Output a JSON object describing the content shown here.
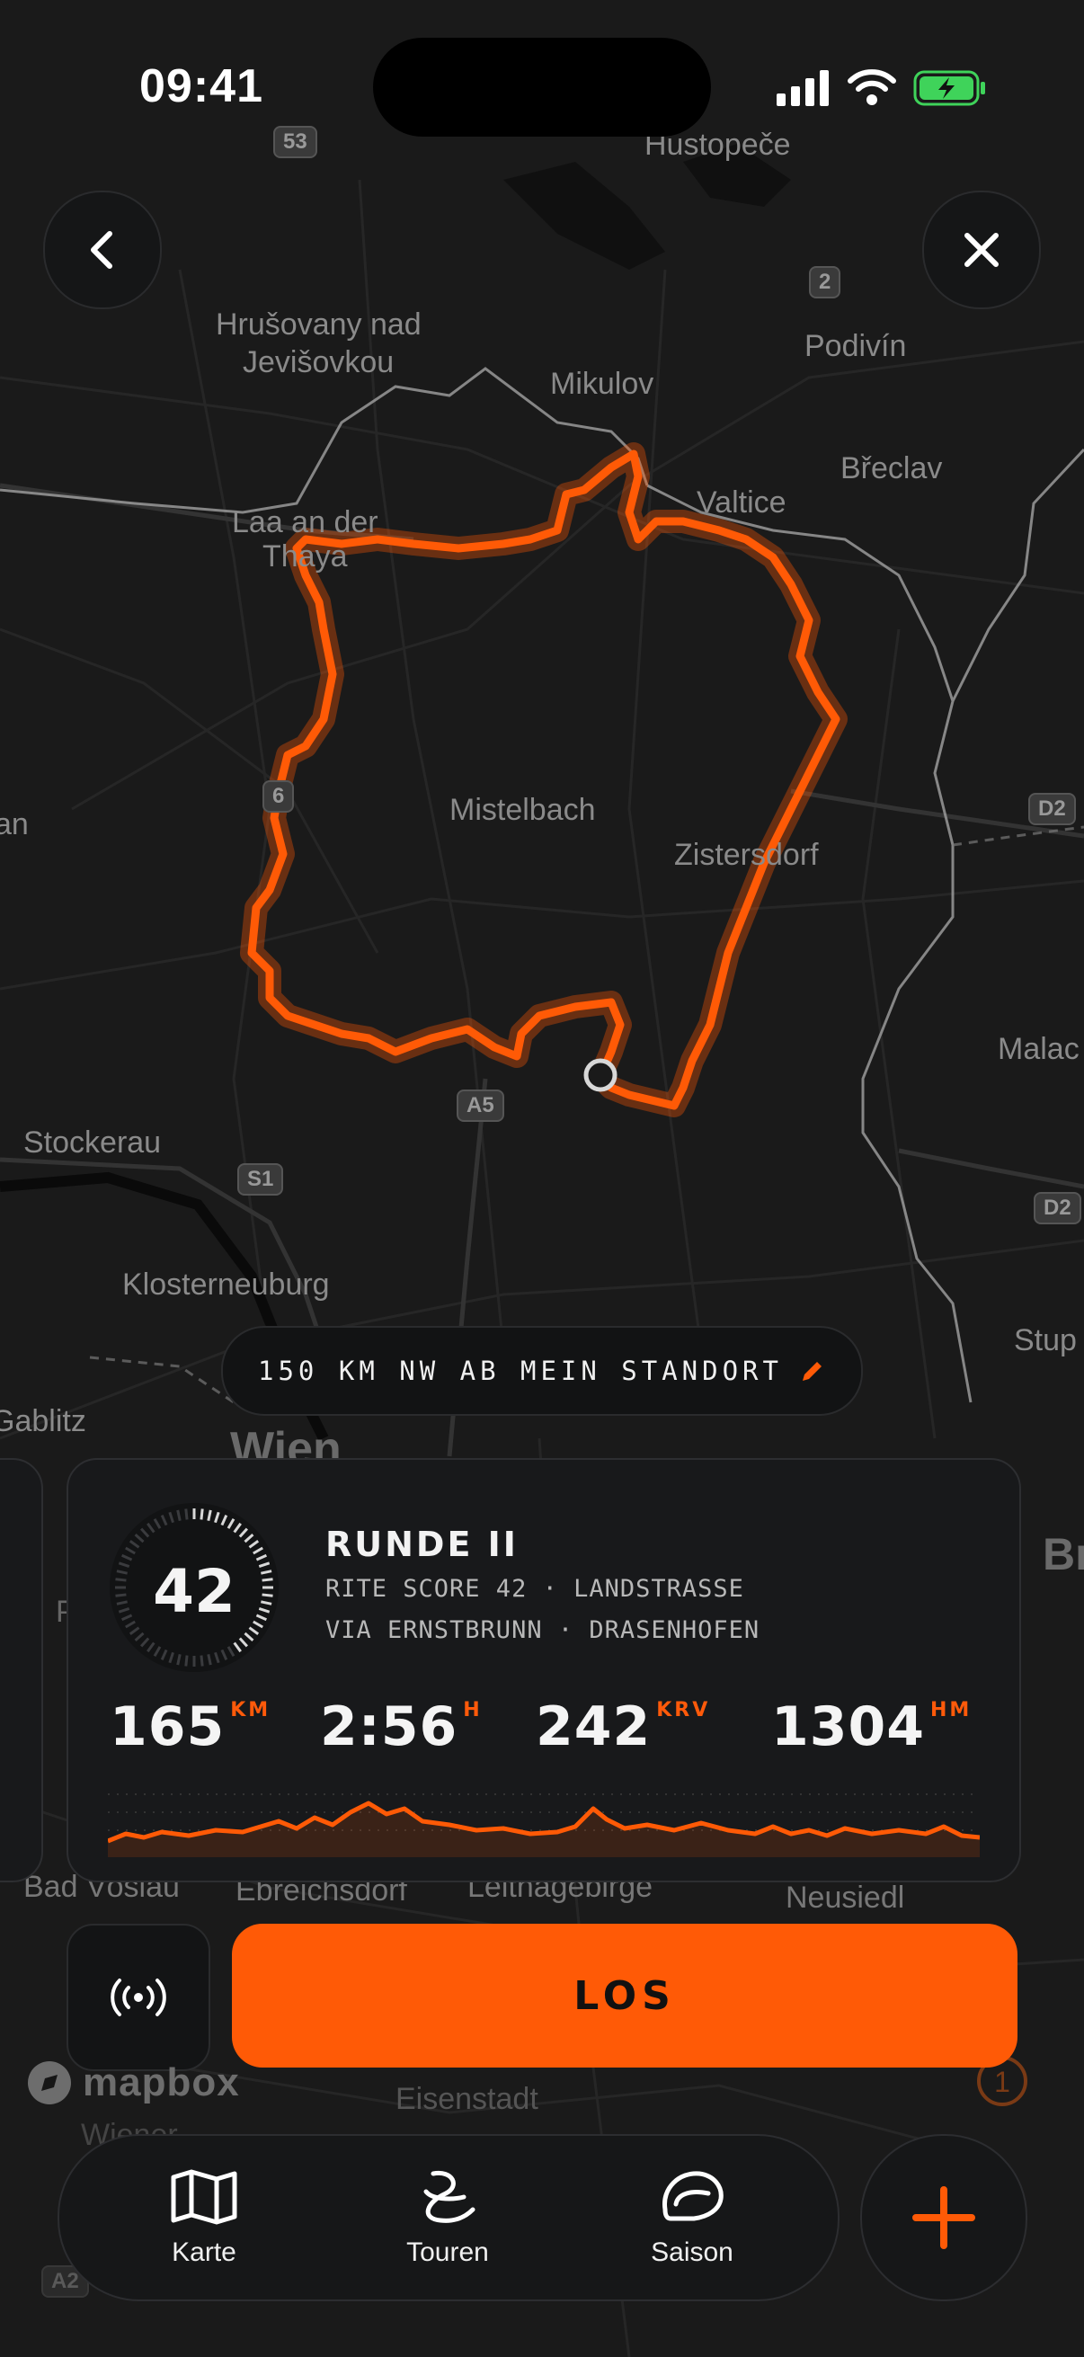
{
  "status_bar": {
    "time": "09:41"
  },
  "map": {
    "places": {
      "hustopece": "Hustopeče",
      "hrusovany": "Hrušovany nad",
      "jevisovkou": "Jevišovkou",
      "podivin": "Podivín",
      "mikulov": "Mikulov",
      "breclav": "Břeclav",
      "valtice": "Valtice",
      "laa": "Laa an der",
      "thaya": "Thaya",
      "mistelbach": "Mistelbach",
      "zistersdorf": "Zistersdorf",
      "an": "an",
      "malac": "Malac",
      "stockerau": "Stockerau",
      "klosterneuburg": "Klosterneuburg",
      "stup": "Stup",
      "gablitz": "Gablitz",
      "wien": "Wien",
      "br": "Br",
      "p": "P",
      "bad_voslau": "Bad Vöslau",
      "ebreichsdorf": "Ebreichsdorf",
      "leithagebirge": "Leithagebirge",
      "neusiedl": "Neusiedl",
      "eisenstadt": "Eisenstadt",
      "wiener": "Wiener"
    },
    "shields": {
      "s53": "53",
      "s2": "2",
      "s6": "6",
      "a5": "A5",
      "s1": "S1",
      "d2a": "D2",
      "d2b": "D2",
      "a2": "A2"
    },
    "marker_badge": "1",
    "attribution": "mapbox"
  },
  "destination_pill": {
    "label": "150 KM NW AB MEIN STANDORT"
  },
  "route_card": {
    "score": "42",
    "score_value": 42,
    "title": "RUNDE II",
    "subtitle_line1": "RITE SCORE 42 · LANDSTRASSE",
    "subtitle_line2": "VIA ERNSTBRUNN · DRASENHOFEN",
    "stats": [
      {
        "value": "165",
        "unit": "KM"
      },
      {
        "value": "2:56",
        "unit": "H"
      },
      {
        "value": "242",
        "unit": "KRV"
      },
      {
        "value": "1304",
        "unit": "HM"
      }
    ]
  },
  "actions": {
    "go_label": "LOS"
  },
  "tab_bar": {
    "tabs": [
      {
        "label": "Karte",
        "icon": "map-icon"
      },
      {
        "label": "Touren",
        "icon": "route-icon"
      },
      {
        "label": "Saison",
        "icon": "helmet-icon"
      }
    ],
    "add_icon": "plus-icon"
  },
  "colors": {
    "accent": "#FF5A06",
    "background": "#161616",
    "card": "#18191B"
  }
}
